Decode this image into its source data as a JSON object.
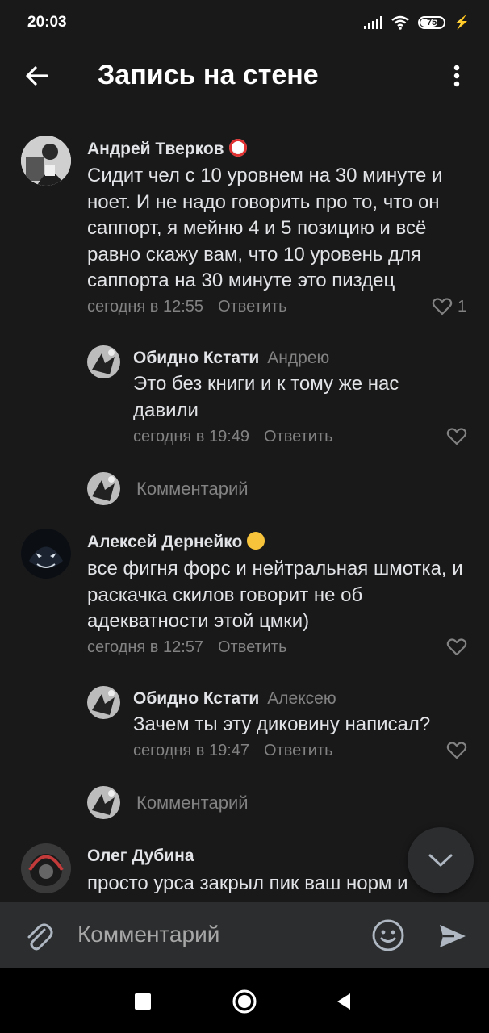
{
  "status": {
    "time": "20:03",
    "battery": "75"
  },
  "header": {
    "title": "Запись на стене"
  },
  "comments": [
    {
      "author": "Андрей Тверков",
      "emoji": "clown-face",
      "text": "Сидит чел с 10 уровнем на 30 минуте и ноет. И не надо говорить про то, что он саппорт, я мейню 4 и 5 позицию и всё равно скажу вам, что 10 уровень для саппорта на 30 минуте это пиздец",
      "time": "сегодня в 12:55",
      "reply_label": "Ответить",
      "likes": "1"
    },
    {
      "author": "Обидно Кстати",
      "reply_to": "Андрею",
      "text": "Это без книги и к тому же нас давили",
      "time": "сегодня в 19:49",
      "reply_label": "Ответить"
    },
    {
      "author": "Алексей Дернейко",
      "emoji": "sunglasses-face",
      "text": "все фигня форс и нейтральная шмотка, и раскачка скилов говорит не об адекватности этой цмки)",
      "time": "сегодня в 12:57",
      "reply_label": "Ответить"
    },
    {
      "author": "Обидно Кстати",
      "reply_to": "Алексею",
      "text": "Зачем ты эту диковину написал?",
      "time": "сегодня в 19:47",
      "reply_label": "Ответить"
    },
    {
      "author": "Олег Дубина",
      "text": "просто урса закрыл пик ваш норм и"
    }
  ],
  "thread_reply_placeholder": "Комментарий",
  "composer": {
    "placeholder": "Комментарий"
  },
  "colors": {
    "background": "#19191a",
    "panel": "#2c2d2e",
    "text": "#e1e3e6",
    "secondary": "#828282"
  }
}
